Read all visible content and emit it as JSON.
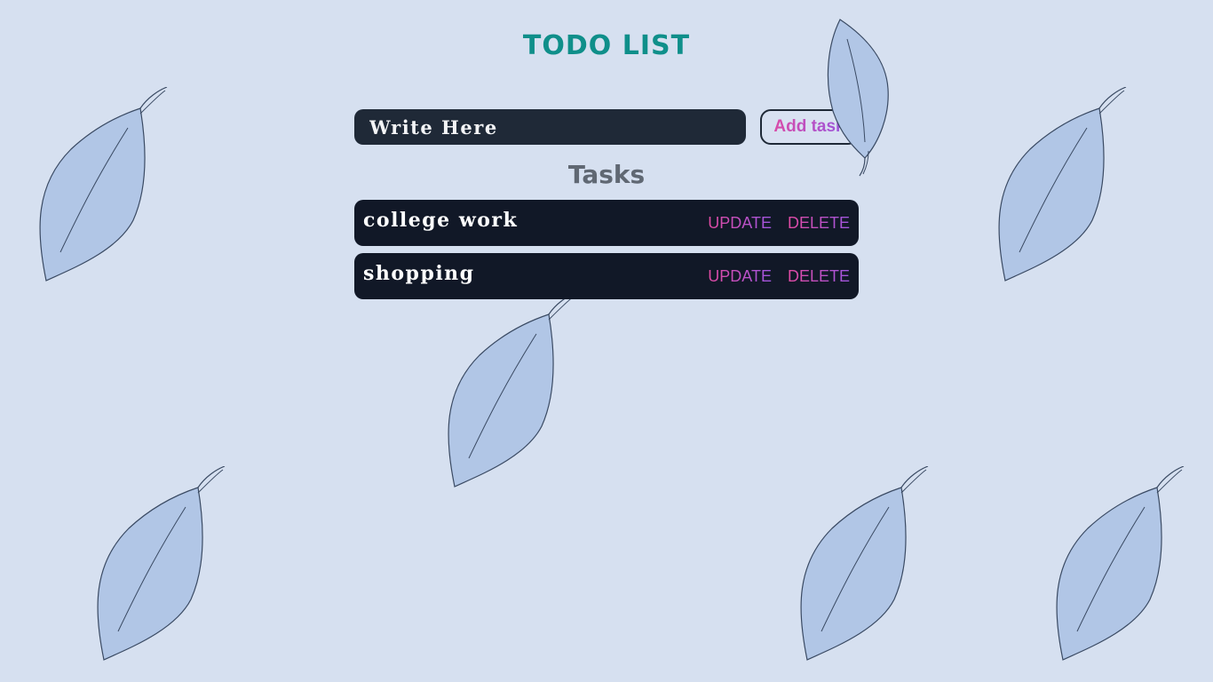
{
  "app": {
    "title": "TODO LIST"
  },
  "form": {
    "input_placeholder": "Write Here",
    "input_value": "",
    "add_label": "Add task"
  },
  "tasks": {
    "heading": "Tasks",
    "items": [
      {
        "text": "college work",
        "update_label": "UPDATE",
        "delete_label": "DELETE"
      },
      {
        "text": "shopping",
        "update_label": "UPDATE",
        "delete_label": "DELETE"
      }
    ]
  },
  "theme": {
    "background": "#d6e0f0",
    "title_color": "#0f8f8a",
    "panel": "#111827",
    "input_bg": "#1f2937",
    "leaf_fill": "#b1c6e6",
    "leaf_stroke": "#3a4a63",
    "action_gradient": [
      "#e04aa2",
      "#a056e0"
    ]
  },
  "decorations": {
    "leaf_icon": "leaf-icon"
  }
}
